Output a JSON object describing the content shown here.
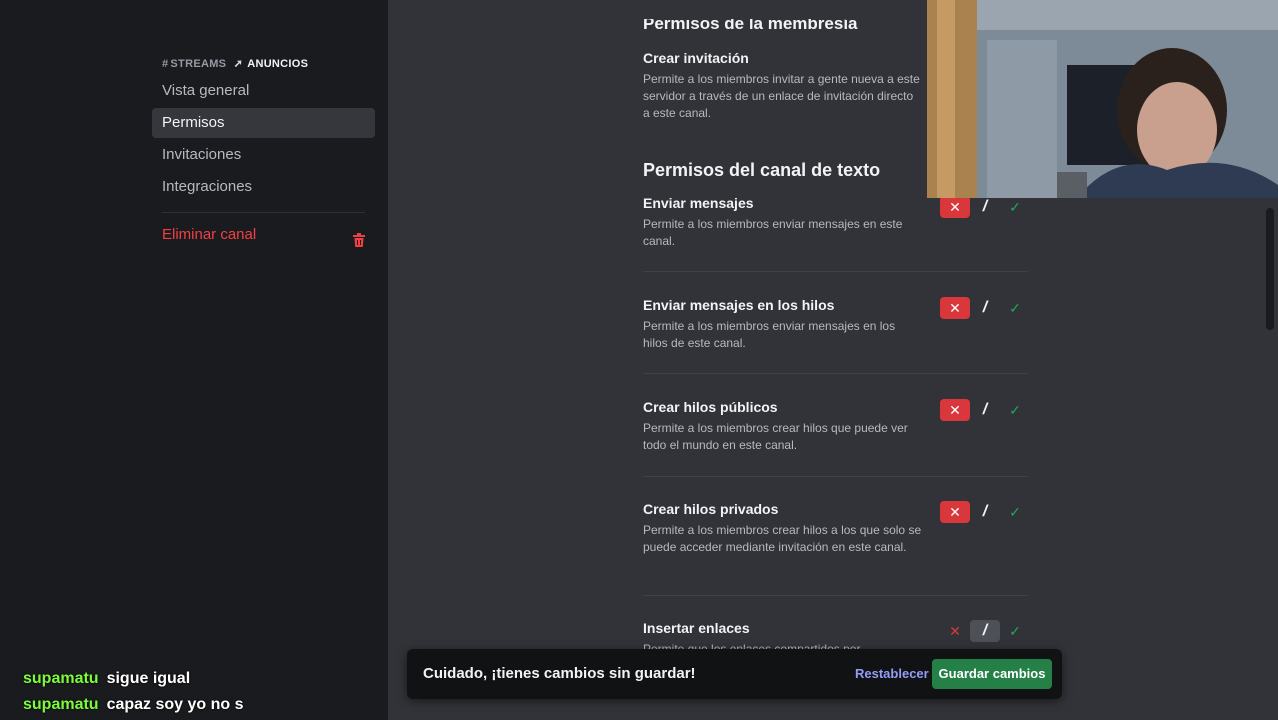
{
  "sidebar": {
    "header_hash": "#",
    "header_channel": "STREAMS",
    "header_sub": "ANUNCIOS",
    "items": [
      {
        "label": "Vista general"
      },
      {
        "label": "Permisos"
      },
      {
        "label": "Invitaciones"
      },
      {
        "label": "Integraciones"
      }
    ],
    "delete_label": "Eliminar canal"
  },
  "chat": [
    {
      "user": "supamatu",
      "message": "sigue igual"
    },
    {
      "user": "supamatu",
      "message": "capaz soy yo no s"
    }
  ],
  "main": {
    "membership_section_partial": "Permisos de la membresía",
    "create_invite": {
      "title": "Crear invitación",
      "desc": "Permite a los miembros invitar a gente nueva a este servidor a través de un enlace de invitación directo a este canal."
    },
    "text_section_title": "Permisos del canal de texto",
    "permissions": [
      {
        "title": "Enviar mensajes",
        "desc": "Permite a los miembros enviar mensajes en este canal.",
        "state": "deny"
      },
      {
        "title": "Enviar mensajes en los hilos",
        "desc": "Permite a los miembros enviar mensajes en los hilos de este canal.",
        "state": "deny"
      },
      {
        "title": "Crear hilos públicos",
        "desc": "Permite a los miembros crear hilos que puede ver todo el mundo en este canal.",
        "state": "deny"
      },
      {
        "title": "Crear hilos privados",
        "desc": "Permite a los miembros crear hilos a los que solo se puede acceder mediante invitación en este canal.",
        "state": "deny"
      },
      {
        "title": "Insertar enlaces",
        "desc": "Permite que los enlaces compartidos por",
        "state": "neutral"
      }
    ],
    "toggle_glyphs": {
      "deny": "✕",
      "neutral": "/",
      "allow": "✓"
    }
  },
  "unsaved_bar": {
    "warning": "Cuidado, ¡tienes cambios sin guardar!",
    "reset_label": "Restablecer",
    "save_label": "Guardar cambios"
  },
  "colors": {
    "deny": "#da373c",
    "allow": "#23a55a",
    "save": "#248046",
    "danger": "#f23f43",
    "chat_user": "#7cfc3a"
  }
}
